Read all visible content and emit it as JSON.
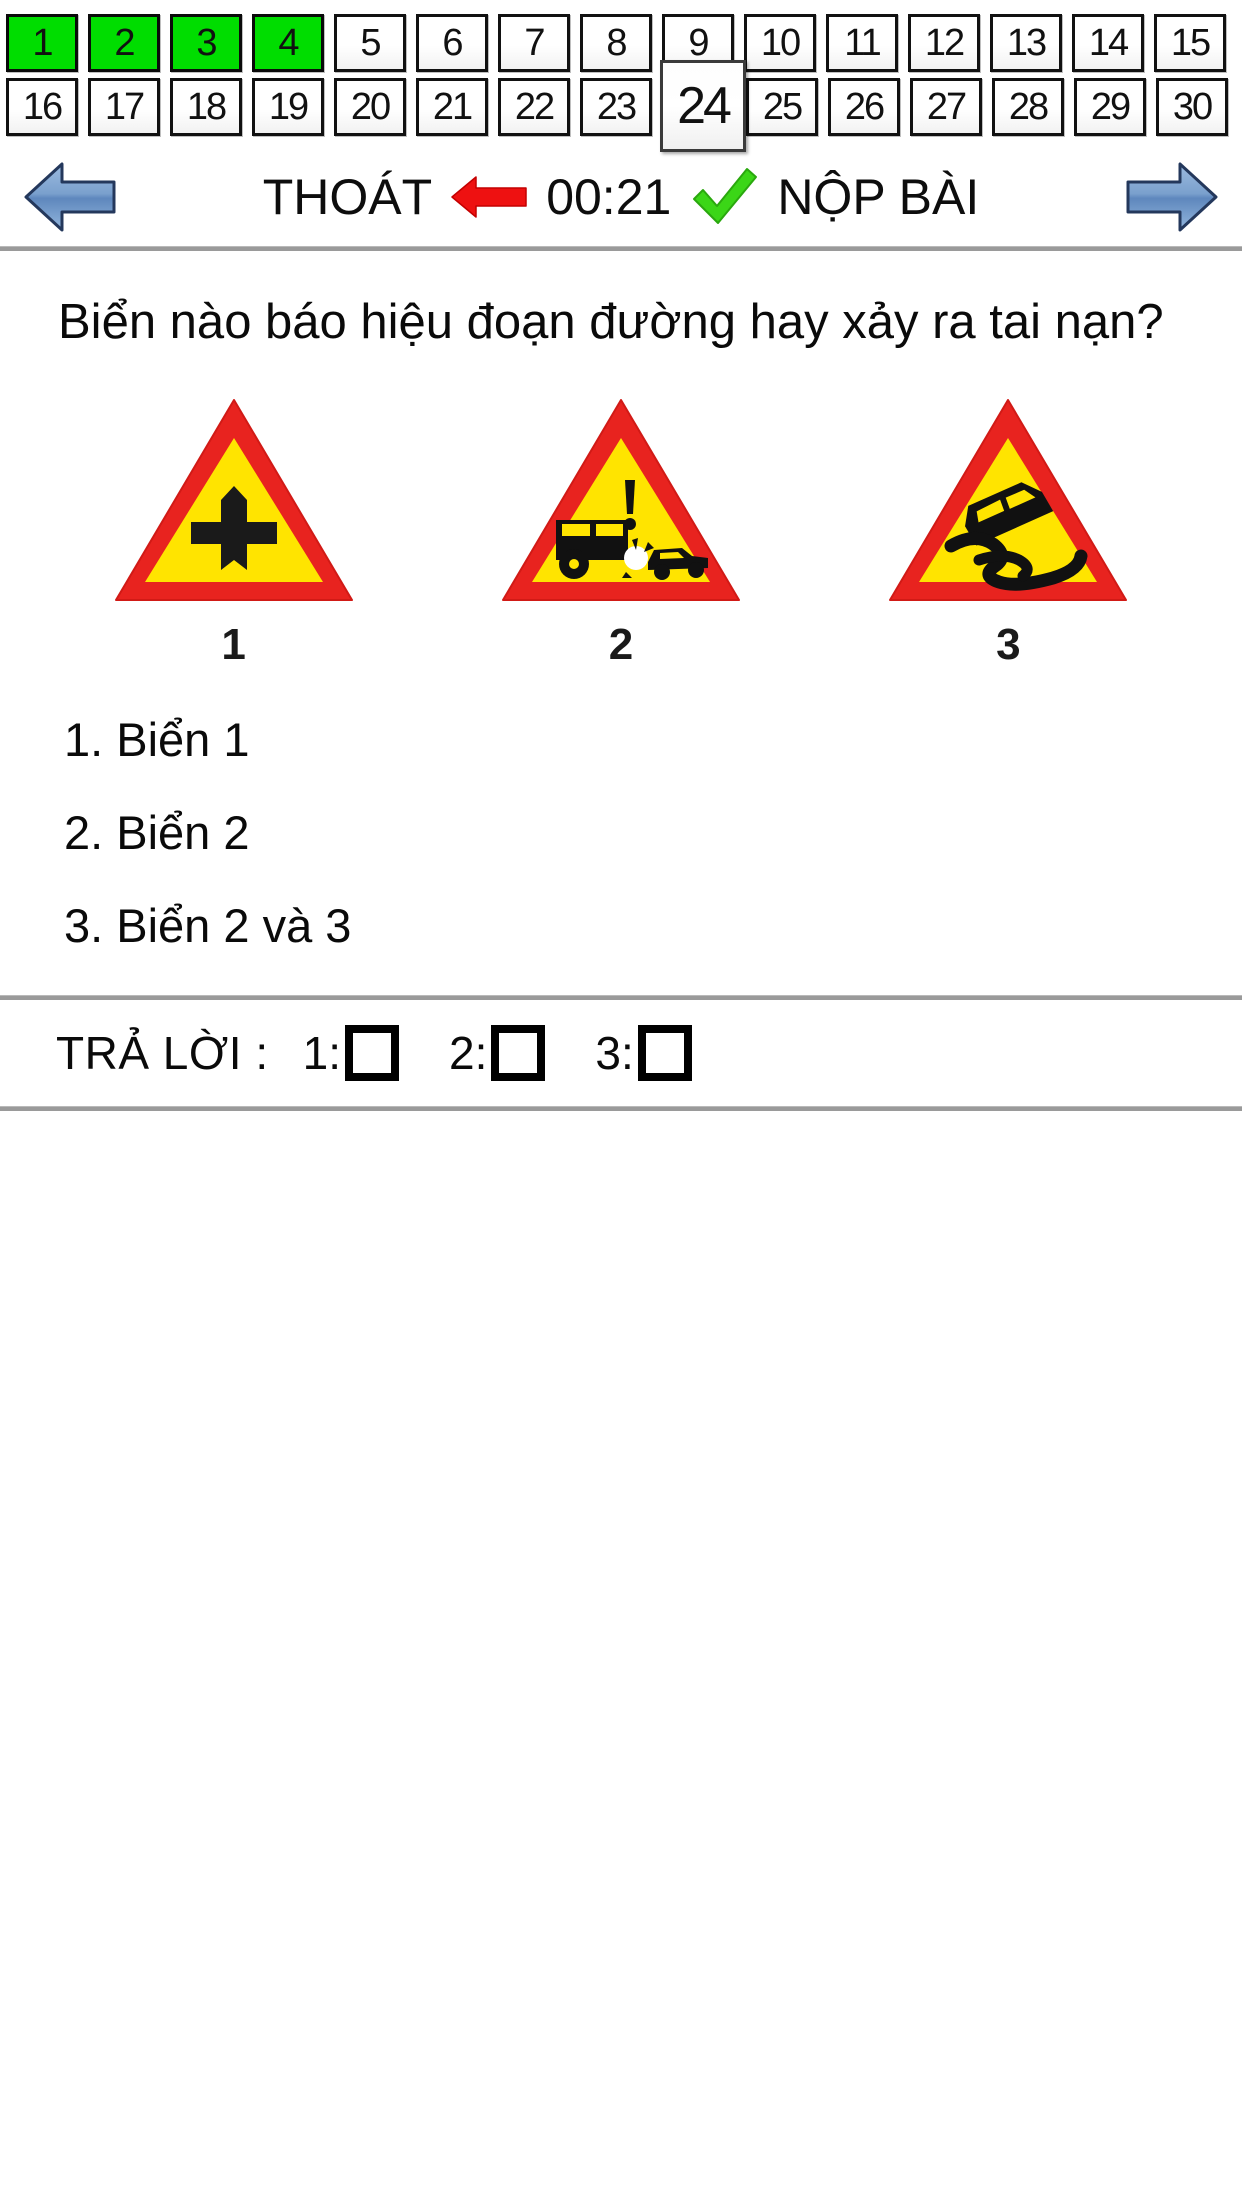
{
  "question_nav": {
    "rows": [
      [
        {
          "label": "1",
          "state": "answered"
        },
        {
          "label": "2",
          "state": "answered"
        },
        {
          "label": "3",
          "state": "answered"
        },
        {
          "label": "4",
          "state": "answered"
        },
        {
          "label": "5",
          "state": "unanswered"
        },
        {
          "label": "6",
          "state": "unanswered"
        },
        {
          "label": "7",
          "state": "unanswered"
        },
        {
          "label": "8",
          "state": "unanswered"
        },
        {
          "label": "9",
          "state": "unanswered"
        },
        {
          "label": "10",
          "state": "unanswered"
        },
        {
          "label": "11",
          "state": "unanswered"
        },
        {
          "label": "12",
          "state": "unanswered"
        },
        {
          "label": "13",
          "state": "unanswered"
        },
        {
          "label": "14",
          "state": "unanswered"
        },
        {
          "label": "15",
          "state": "unanswered"
        }
      ],
      [
        {
          "label": "16",
          "state": "unanswered"
        },
        {
          "label": "17",
          "state": "unanswered"
        },
        {
          "label": "18",
          "state": "unanswered"
        },
        {
          "label": "19",
          "state": "unanswered"
        },
        {
          "label": "20",
          "state": "unanswered"
        },
        {
          "label": "21",
          "state": "unanswered"
        },
        {
          "label": "22",
          "state": "unanswered"
        },
        {
          "label": "23",
          "state": "unanswered"
        },
        {
          "label": "24",
          "state": "current"
        },
        {
          "label": "25",
          "state": "unanswered"
        },
        {
          "label": "26",
          "state": "unanswered"
        },
        {
          "label": "27",
          "state": "unanswered"
        },
        {
          "label": "28",
          "state": "unanswered"
        },
        {
          "label": "29",
          "state": "unanswered"
        },
        {
          "label": "30",
          "state": "unanswered"
        }
      ]
    ],
    "answered_color": "#00dd00",
    "current_question": "24"
  },
  "toolbar": {
    "prev_icon": "arrow-left-blue-icon",
    "exit_label": "THOÁT",
    "exit_icon": "arrow-left-red-icon",
    "timer": "00:21",
    "submit_icon": "checkmark-green-icon",
    "submit_label": "NỘP BÀI",
    "next_icon": "arrow-right-blue-icon",
    "colors": {
      "nav_arrow": "#6e95c9",
      "exit_arrow": "#ee1111",
      "check": "#3bd617"
    }
  },
  "question": {
    "text": "Biển nào báo hiệu đoạn đường hay xảy ra tai nạn?"
  },
  "signs": [
    {
      "label": "1",
      "icon": "crossroads-warning-sign",
      "border_color": "#e8231f",
      "fill_color": "#ffe400"
    },
    {
      "label": "2",
      "icon": "accident-warning-sign",
      "border_color": "#e8231f",
      "fill_color": "#ffe400"
    },
    {
      "label": "3",
      "icon": "slippery-road-sign",
      "border_color": "#e8231f",
      "fill_color": "#ffe400"
    }
  ],
  "options": [
    {
      "text": "1. Biển 1"
    },
    {
      "text": "2. Biển 2"
    },
    {
      "text": "3. Biển 2 và 3"
    }
  ],
  "answer_bar": {
    "label": "TRẢ LỜI :",
    "choices": [
      {
        "num": "1:",
        "checked": false
      },
      {
        "num": "2:",
        "checked": false
      },
      {
        "num": "3:",
        "checked": false
      }
    ]
  }
}
